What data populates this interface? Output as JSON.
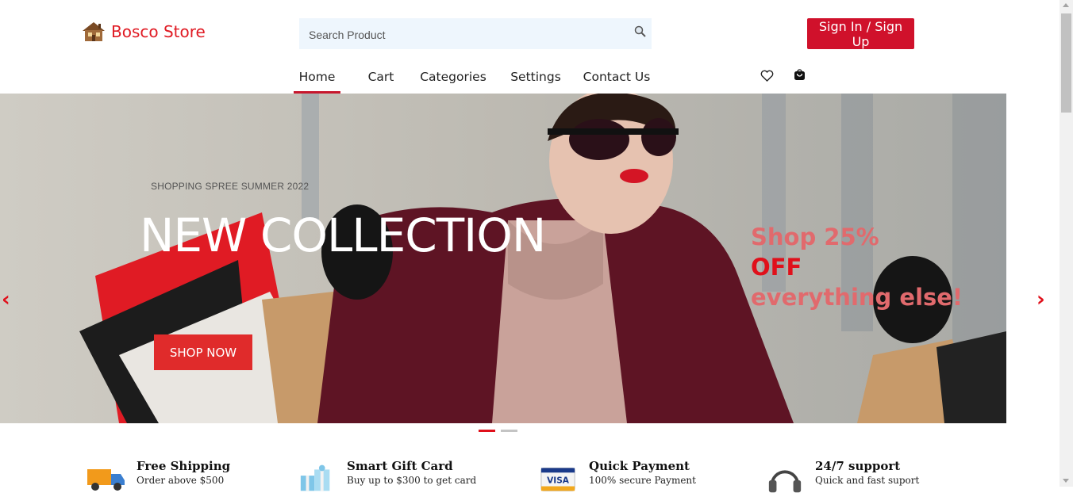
{
  "header": {
    "brand": "Bosco Store",
    "search_placeholder": "Search Product",
    "signin_label": "Sign In / Sign Up"
  },
  "nav": {
    "items": [
      {
        "label": "Home",
        "active": true
      },
      {
        "label": "Cart"
      },
      {
        "label": "Categories"
      },
      {
        "label": "Settings"
      },
      {
        "label": "Contact Us"
      }
    ],
    "icons": [
      "heart-icon",
      "shopping-bag-icon"
    ]
  },
  "hero": {
    "subtitle": "SHOPPING SPREE SUMMER 2022",
    "title": "NEW COLLECTION",
    "button_label": "SHOP NOW",
    "promo_line1": "Shop 25%",
    "promo_line2": "OFF",
    "promo_line3": "everything else!",
    "prev_label": "‹",
    "next_label": "›",
    "slide_count": 2,
    "active_slide": 1
  },
  "features": [
    {
      "title": "Free Shipping",
      "desc": "Order above $500",
      "icon": "delivery-truck-icon"
    },
    {
      "title": "Smart Gift Card",
      "desc": "Buy up to $300 to get card",
      "icon": "gift-icon"
    },
    {
      "title": "Quick Payment",
      "desc": "100% secure Payment",
      "icon": "visa-card-icon"
    },
    {
      "title": "24/7 support",
      "desc": "Quick and fast suport",
      "icon": "headphones-icon"
    }
  ],
  "colors": {
    "brand": "#e01b24",
    "button": "#d0112b",
    "accent": "#e0101b",
    "promo_light": "#e16a6d"
  }
}
